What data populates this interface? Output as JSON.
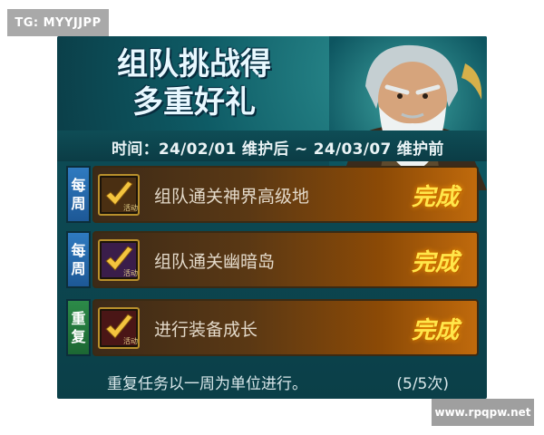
{
  "watermark_top": "TG: MYYJJPP",
  "watermark_site": "www.rpqpw.net",
  "banner": {
    "title_line1": "组队挑战得",
    "title_line2": "多重好礼"
  },
  "time": "时间：24/02/01 维护后 ~ 24/03/07 维护前",
  "tasks": [
    {
      "tag_top": "每",
      "tag_bottom": "周",
      "tag_type": "weekly",
      "label": "组队通关神界高级地",
      "status": "完成",
      "icon": "check-badge-icon",
      "icon_text": "活动"
    },
    {
      "tag_top": "每",
      "tag_bottom": "周",
      "tag_type": "weekly",
      "label": "组队通关幽暗岛",
      "status": "完成",
      "icon": "check-badge-icon",
      "icon_text": "活动"
    },
    {
      "tag_top": "重",
      "tag_bottom": "复",
      "tag_type": "repeat",
      "label": "进行装备成长",
      "status": "完成",
      "icon": "check-badge-icon",
      "icon_text": "活动"
    }
  ],
  "footer": {
    "note": "重复任务以一周为单位进行。",
    "count": "(5/5次)"
  },
  "colors": {
    "panel_bg": "#0c4a54",
    "weekly_tag": "#2f7ac0",
    "repeat_tag": "#2c8a48",
    "done_text": "#ffe64a",
    "task_bar_end": "#c06a0c"
  }
}
